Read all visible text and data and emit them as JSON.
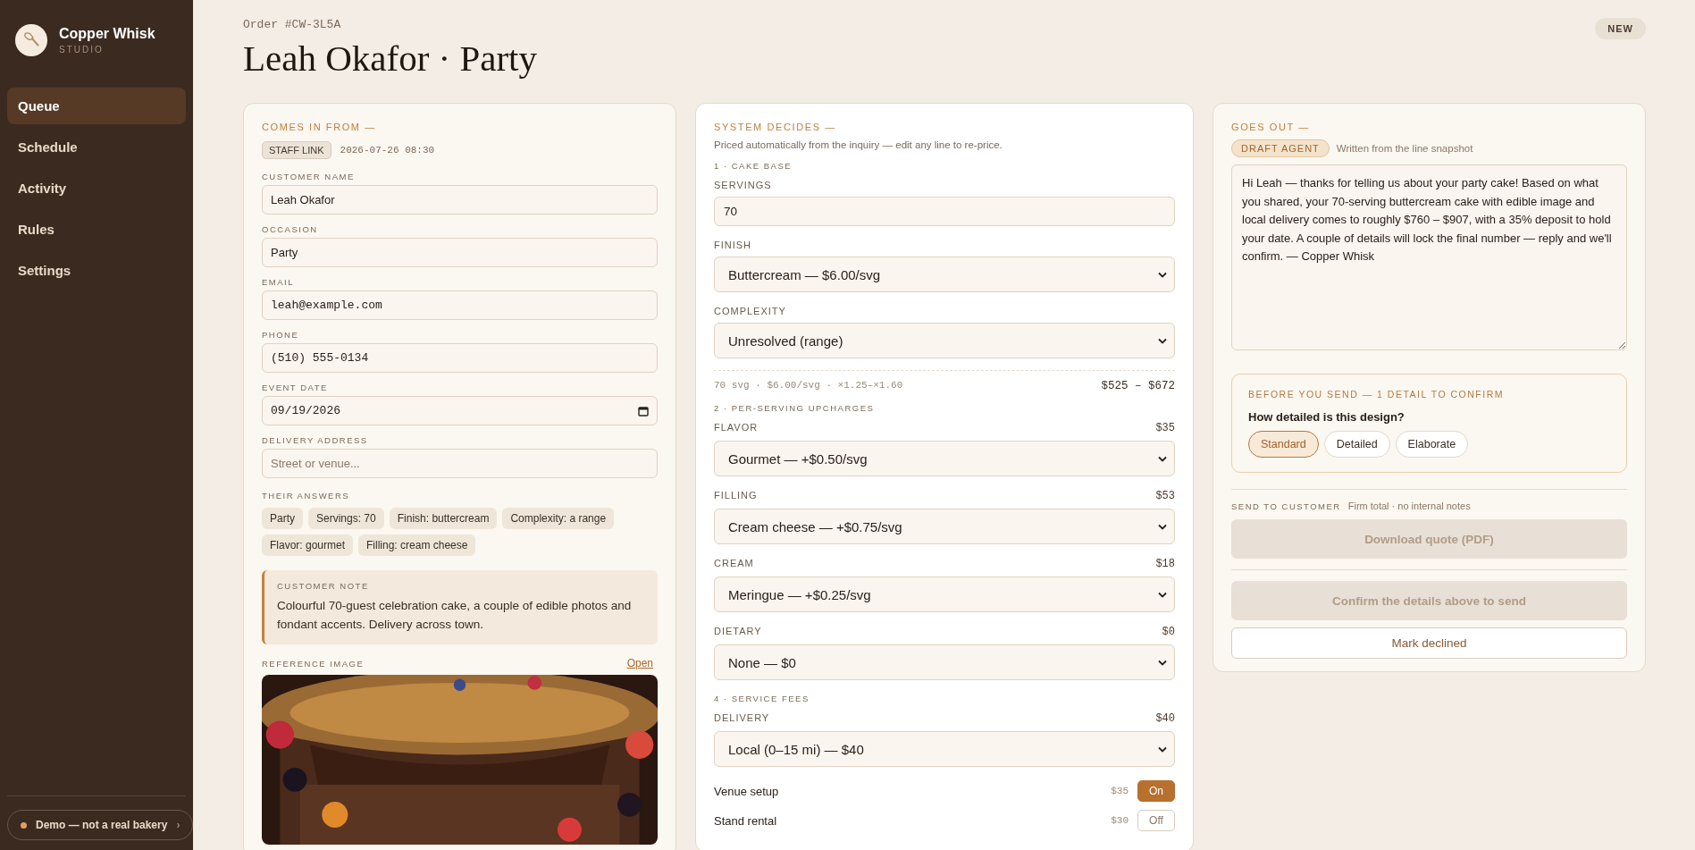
{
  "sidebar": {
    "brand": "Copper Whisk",
    "sub": "STUDIO",
    "items": [
      {
        "label": "Queue",
        "selected": true
      },
      {
        "label": "Schedule",
        "selected": false
      },
      {
        "label": "Activity",
        "selected": false
      },
      {
        "label": "Rules",
        "selected": false
      },
      {
        "label": "Settings",
        "selected": false
      }
    ],
    "demo": {
      "label": "Demo — not a real bakery",
      "chevron": "›"
    }
  },
  "header": {
    "order": "Order #CW-3L5A",
    "title": "Leah Okafor · Party",
    "badge": "NEW"
  },
  "intake": {
    "heading": "COMES IN FROM —",
    "source": "STAFF LINK",
    "received": "2026-07-26 08:30",
    "fields": [
      {
        "label": "CUSTOMER NAME",
        "value": "Leah Okafor",
        "kind": "text"
      },
      {
        "label": "OCCASION",
        "value": "Party",
        "kind": "text"
      },
      {
        "label": "EMAIL",
        "value": "leah@example.com",
        "kind": "mono"
      },
      {
        "label": "PHONE",
        "value": "(510) 555-0134",
        "kind": "mono"
      },
      {
        "label": "EVENT DATE",
        "value": "09/19/2026",
        "kind": "date"
      },
      {
        "label": "DELIVERY ADDRESS",
        "placeholder": "Street or venue...",
        "kind": "text"
      }
    ],
    "answers_label": "THEIR ANSWERS",
    "answers": [
      "Party",
      "Servings: 70",
      "Finish: buttercream",
      "Complexity: a range",
      "Flavor: gourmet",
      "Filling: cream cheese"
    ],
    "note": {
      "label": "CUSTOMER NOTE",
      "text": "Colourful 70-guest celebration cake, a couple of edible photos and fondant accents. Delivery across town."
    },
    "reference": {
      "label": "REFERENCE IMAGE",
      "link": "Open",
      "kind": "picture"
    }
  },
  "pricing": {
    "heading": "SYSTEM DECIDES —",
    "subtitle": "Priced automatically from the inquiry — edit any line to re-price.",
    "sections": [
      {
        "title": "1 · CAKE BASE",
        "rows": [
          {
            "kind": "input",
            "label": "SERVINGS",
            "value": "70"
          },
          {
            "kind": "select",
            "label": "FINISH",
            "value": "Buttercream — $6.00/svg"
          },
          {
            "kind": "select",
            "label": "COMPLEXITY",
            "value": "Unresolved (range)"
          },
          {
            "kind": "summary",
            "formula": "70 svg · $6.00/svg · ×1.25–×1.60",
            "total": "$525 – $672"
          }
        ]
      },
      {
        "title": "2 · PER-SERVING UPCHARGES",
        "rows": [
          {
            "kind": "select",
            "label": "FLAVOR",
            "amount": "$35",
            "value": "Gourmet — +$0.50/svg"
          },
          {
            "kind": "select",
            "label": "FILLING",
            "amount": "$53",
            "value": "Cream cheese — +$0.75/svg"
          },
          {
            "kind": "select",
            "label": "CREAM",
            "amount": "$18",
            "value": "Meringue — +$0.25/svg"
          },
          {
            "kind": "select",
            "label": "DIETARY",
            "amount": "$0",
            "value": "None — $0"
          }
        ]
      },
      {
        "title": "4 · SERVICE FEES",
        "rows": [
          {
            "kind": "select",
            "label": "DELIVERY",
            "amount": "$40",
            "value": "Local (0–15 mi) — $40"
          },
          {
            "kind": "toggle",
            "label": "Venue setup",
            "amount": "$35",
            "on": true,
            "state": "On"
          },
          {
            "kind": "toggle",
            "label": "Stand rental",
            "amount": "$30",
            "on": false,
            "state": "Off"
          }
        ]
      }
    ]
  },
  "outgoing": {
    "heading": "GOES OUT —",
    "tag": "DRAFT AGENT",
    "tag_note": "Written from the line snapshot",
    "message": "Hi Leah — thanks for telling us about your party cake! Based on what you shared, your 70-serving buttercream cake with edible image and local delivery comes to roughly $760 – $907, with a 35% deposit to hold your date. A couple of details will lock the final number — reply and we'll confirm. — Copper Whisk",
    "confirm": {
      "heading": "BEFORE YOU SEND — 1 DETAIL TO CONFIRM",
      "question": "How detailed is this design?",
      "options": [
        {
          "label": "Standard",
          "selected": true
        },
        {
          "label": "Detailed",
          "selected": false
        },
        {
          "label": "Elaborate",
          "selected": false
        }
      ]
    },
    "send": {
      "label": "SEND TO CUSTOMER",
      "note": "Firm total · no internal notes"
    },
    "actions": [
      {
        "label": "Download quote (PDF)",
        "disabled": true
      },
      {
        "label": "Confirm the details above to send",
        "disabled": true
      },
      {
        "label": "Mark declined",
        "disabled": false
      }
    ]
  }
}
